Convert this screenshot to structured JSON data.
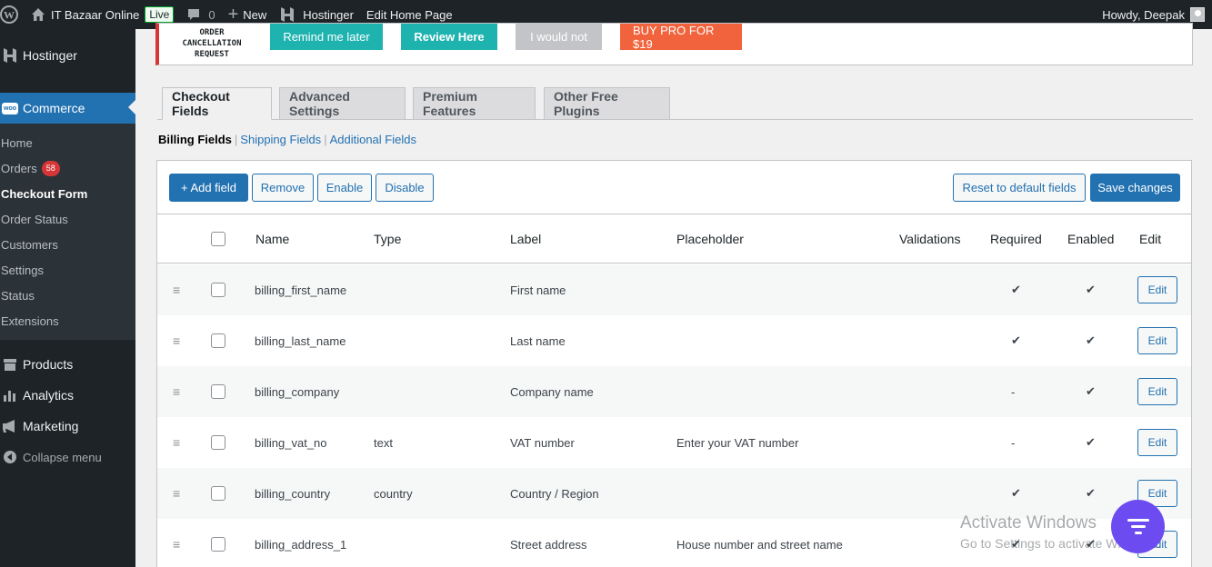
{
  "adminbar": {
    "site_name": "IT Bazaar Online",
    "live": "Live",
    "comments_count": "0",
    "new_label": "New",
    "hostinger": "Hostinger",
    "edit_page": "Edit Home Page",
    "howdy": "Howdy, Deepak"
  },
  "sidebar": {
    "hostinger": "Hostinger",
    "commerce": "Commerce",
    "woo_badge": "woo",
    "submenu": [
      {
        "label": "Home"
      },
      {
        "label": "Orders",
        "count": "58"
      },
      {
        "label": "Checkout Form"
      },
      {
        "label": "Order Status"
      },
      {
        "label": "Customers"
      },
      {
        "label": "Settings"
      },
      {
        "label": "Status"
      },
      {
        "label": "Extensions"
      }
    ],
    "products": "Products",
    "analytics": "Analytics",
    "marketing": "Marketing",
    "collapse": "Collapse menu"
  },
  "notice": {
    "image_text": "ORDER CANCELLATION REQUEST",
    "remind": "Remind me later",
    "review": "Review Here",
    "would_not": "I would not",
    "buy_pro": "BUY PRO FOR $19"
  },
  "tabs": [
    "Checkout Fields",
    "Advanced Settings",
    "Premium Features",
    "Other Free Plugins"
  ],
  "sections": {
    "current": "Billing Fields",
    "shipping": "Shipping Fields",
    "additional": "Additional Fields",
    "sep": "|"
  },
  "toolbar": {
    "add_field": "+ Add field",
    "remove": "Remove",
    "enable": "Enable",
    "disable": "Disable",
    "reset": "Reset to default fields",
    "save": "Save changes"
  },
  "table": {
    "headers": {
      "name": "Name",
      "type": "Type",
      "label": "Label",
      "placeholder": "Placeholder",
      "validations": "Validations",
      "required": "Required",
      "enabled": "Enabled",
      "edit": "Edit"
    },
    "rows": [
      {
        "name": "billing_first_name",
        "type": "",
        "label": "First name",
        "placeholder": "",
        "required": "✔",
        "enabled": "✔",
        "edit": "Edit"
      },
      {
        "name": "billing_last_name",
        "type": "",
        "label": "Last name",
        "placeholder": "",
        "required": "✔",
        "enabled": "✔",
        "edit": "Edit"
      },
      {
        "name": "billing_company",
        "type": "",
        "label": "Company name",
        "placeholder": "",
        "required": "-",
        "enabled": "✔",
        "edit": "Edit"
      },
      {
        "name": "billing_vat_no",
        "type": "text",
        "label": "VAT number",
        "placeholder": "Enter your VAT number",
        "required": "-",
        "enabled": "✔",
        "edit": "Edit"
      },
      {
        "name": "billing_country",
        "type": "country",
        "label": "Country / Region",
        "placeholder": "",
        "required": "✔",
        "enabled": "✔",
        "edit": "Edit"
      },
      {
        "name": "billing_address_1",
        "type": "",
        "label": "Street address",
        "placeholder": "House number and street name",
        "required": "✔",
        "enabled": "✔",
        "edit": "Edit"
      }
    ]
  },
  "watermark": {
    "line1": "Activate Windows",
    "line2": "Go to Settings to activate Windows."
  },
  "colors": {
    "admin_dark": "#1d2327",
    "primary": "#2271b1",
    "teal": "#00a8a8",
    "orange": "#f1633c",
    "fab": "#6c4cf1"
  }
}
